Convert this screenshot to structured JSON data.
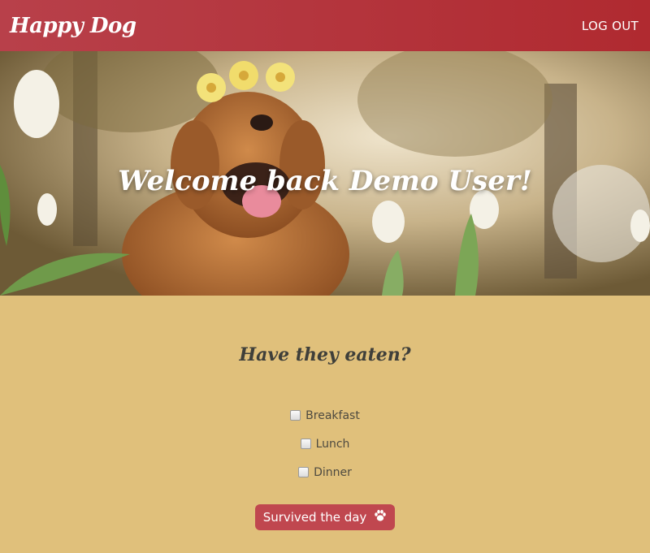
{
  "nav": {
    "brand": "Happy Dog",
    "logout_label": "LOG OUT"
  },
  "hero": {
    "welcome_text": "Welcome back Demo User!"
  },
  "meals_section": {
    "title": "Have they eaten?",
    "items": [
      {
        "label": "Breakfast",
        "checked": false
      },
      {
        "label": "Lunch",
        "checked": false
      },
      {
        "label": "Dinner",
        "checked": false
      }
    ],
    "button_label": "Survived the day",
    "button_icon": "paw-icon"
  },
  "colors": {
    "navbar": "#b3333a",
    "page_background": "#e0c07b",
    "button": "#c0474f",
    "heading_text": "#3f3f3a"
  }
}
